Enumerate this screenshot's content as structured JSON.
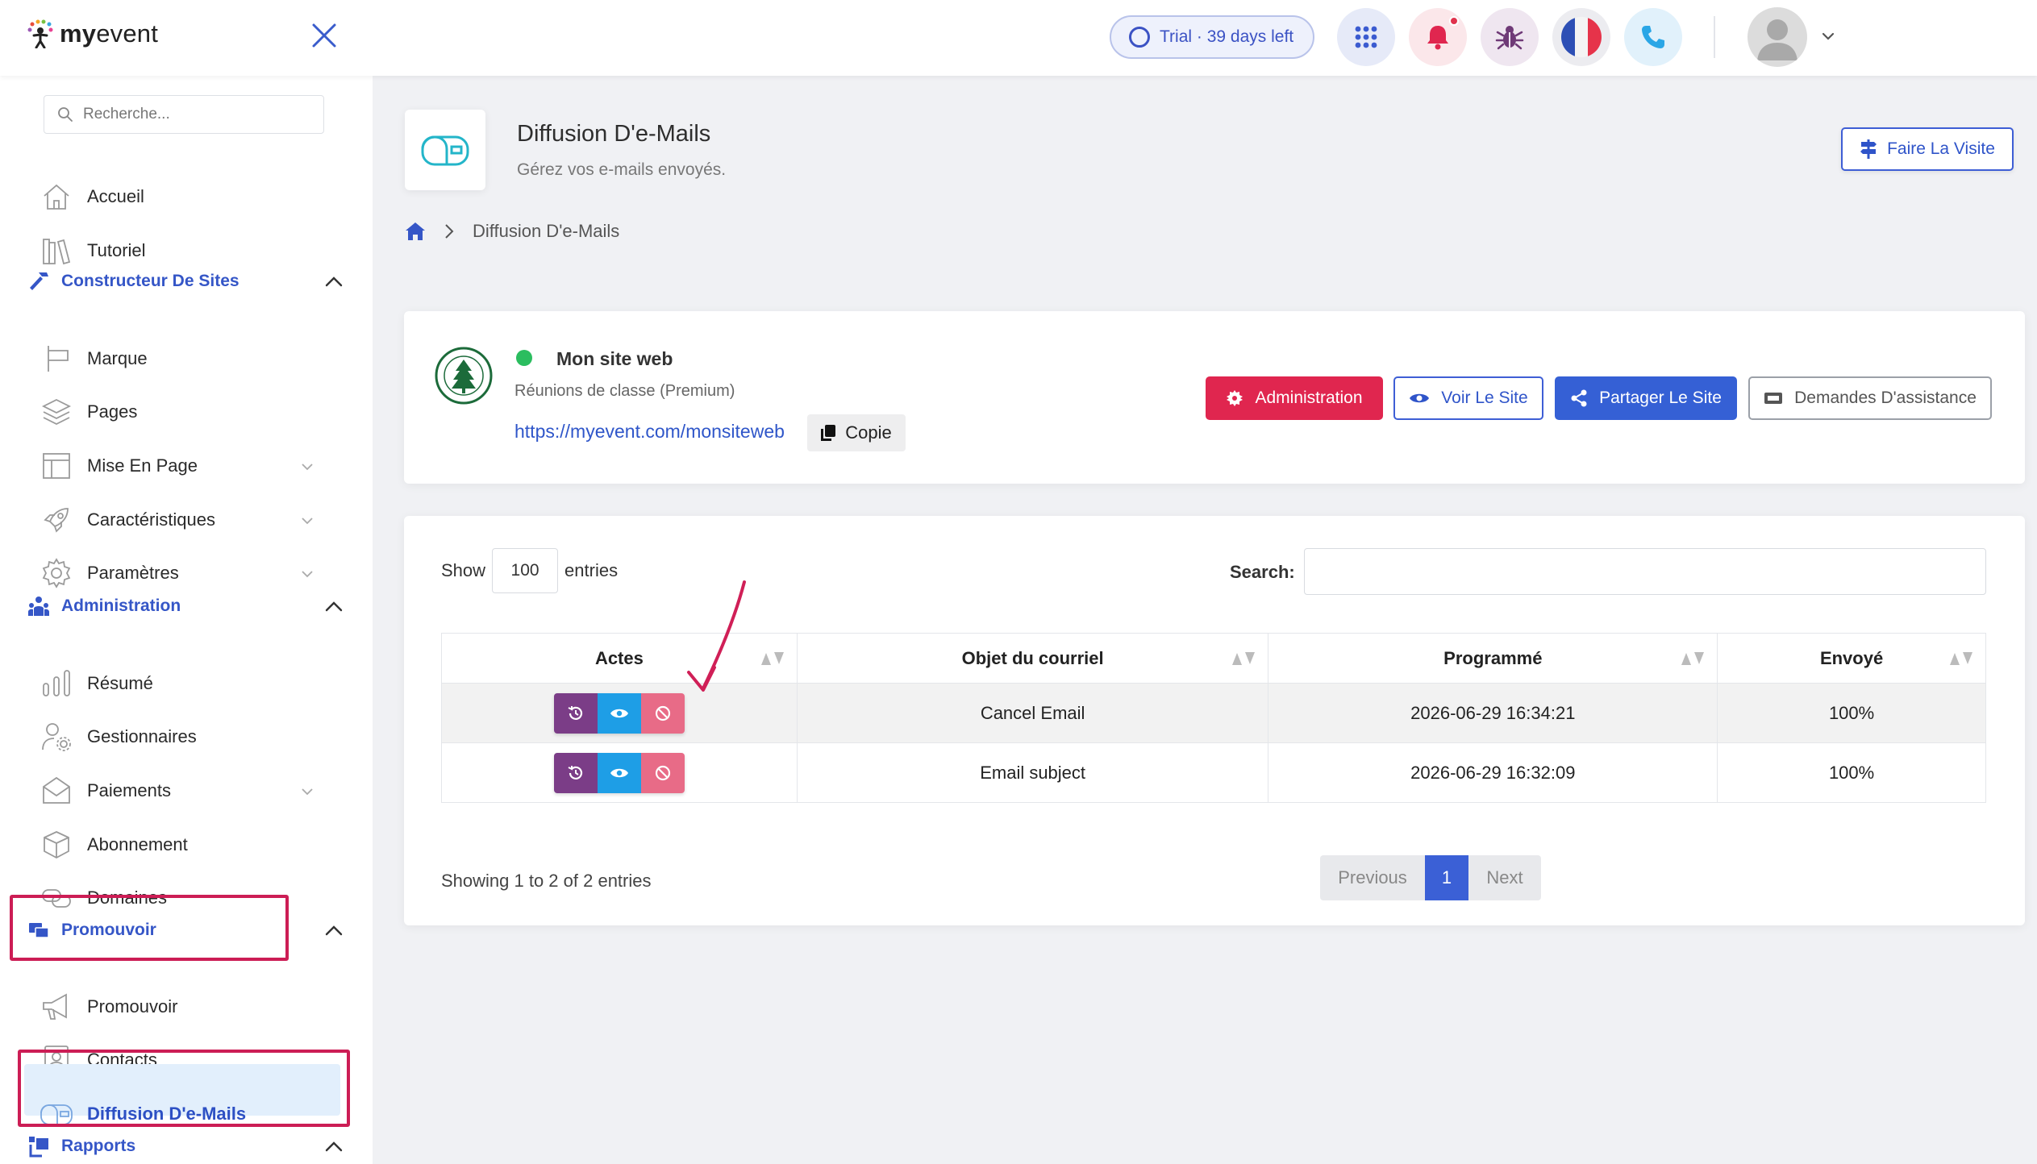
{
  "topbar": {
    "logo_brand": "my",
    "logo_rest": "event",
    "trial_text": "Trial · 39 days left",
    "icons": [
      "apps-grid-icon",
      "bell-icon",
      "bug-icon",
      "france-flag-icon",
      "phone-icon"
    ]
  },
  "sidebar": {
    "search_placeholder": "Recherche...",
    "items": {
      "accueil": "Accueil",
      "tutoriel": "Tutoriel",
      "marque": "Marque",
      "pages": "Pages",
      "mise_en_page": "Mise En Page",
      "caracteristiques": "Caractéristiques",
      "parametres": "Paramètres",
      "resume": "Résumé",
      "gestionnaires": "Gestionnaires",
      "paiements": "Paiements",
      "abonnement": "Abonnement",
      "domaines": "Domaines",
      "promouvoir": "Promouvoir",
      "contacts": "Contacts",
      "diffusion": "Diffusion D'e-Mails"
    },
    "sections": {
      "constructeur": "Constructeur De Sites",
      "administration": "Administration",
      "promouvoir": "Promouvoir",
      "rapports": "Rapports"
    }
  },
  "header": {
    "title": "Diffusion D'e-Mails",
    "subtitle": "Gérez vos e-mails envoyés.",
    "tour_button": "Faire La Visite",
    "breadcrumb_current": "Diffusion D'e-Mails"
  },
  "site": {
    "name": "Mon site web",
    "type": "Réunions de classe (Premium)",
    "url": "https://myevent.com/monsiteweb",
    "copy_label": "Copie",
    "buttons": {
      "administration": "Administration",
      "voir": "Voir Le Site",
      "partager": "Partager Le Site",
      "assistance": "Demandes D'assistance"
    },
    "colors": {
      "admin": "#e0264f",
      "share": "#3560d5",
      "status": "#2bbd5f"
    }
  },
  "table": {
    "show_label": "Show",
    "entries_value": "100",
    "entries_label": "entries",
    "search_label": "Search:",
    "columns": {
      "actes": "Actes",
      "objet": "Objet du courriel",
      "programme": "Programmé",
      "envoye": "Envoyé"
    },
    "rows": [
      {
        "subject": "Cancel Email",
        "scheduled": "2026-06-29 16:34:21",
        "sent": "100%"
      },
      {
        "subject": "Email subject",
        "scheduled": "2026-06-29 16:32:09",
        "sent": "100%"
      }
    ],
    "info": "Showing 1 to 2 of 2 entries",
    "pager": {
      "previous": "Previous",
      "page": "1",
      "next": "Next"
    }
  }
}
